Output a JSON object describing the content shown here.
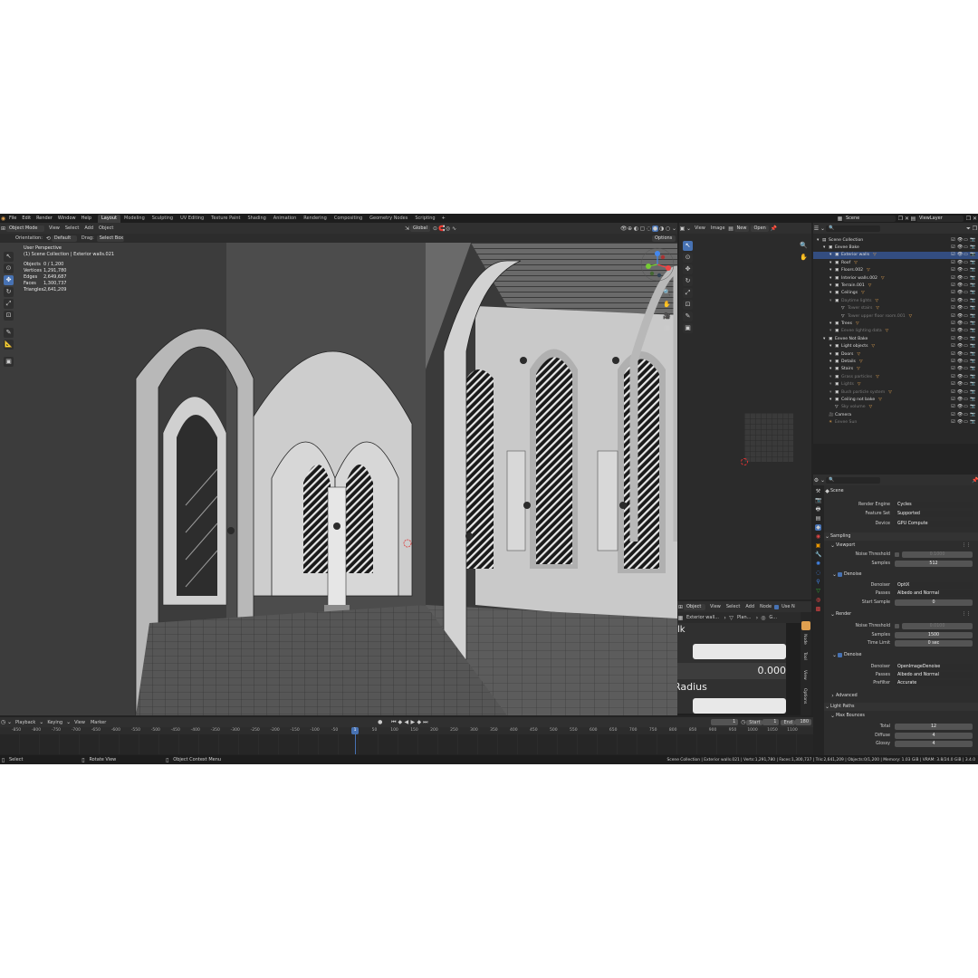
{
  "menu": {
    "items": [
      "File",
      "Edit",
      "Render",
      "Window",
      "Help"
    ],
    "workspaces": [
      "Layout",
      "Modeling",
      "Sculpting",
      "UV Editing",
      "Texture Paint",
      "Shading",
      "Animation",
      "Rendering",
      "Compositing",
      "Geometry Nodes",
      "Scripting"
    ],
    "active_workspace": "Layout",
    "add_tab": "+",
    "scene": "Scene",
    "view_layer": "ViewLayer"
  },
  "viewport": {
    "mode": "Object Mode",
    "menus": [
      "View",
      "Select",
      "Add",
      "Object"
    ],
    "orientation_label": "Orientation:",
    "orientation": "Default",
    "drag_label": "Drag:",
    "drag": "Select Box",
    "transform_orientation": "Global",
    "options": "Options",
    "title": "User Perspective",
    "subtitle": "(1) Scene Collection | Exterior walls.021",
    "stats": [
      {
        "k": "Objects",
        "v": "0 / 1,200"
      },
      {
        "k": "Vertices",
        "v": "1,291,780"
      },
      {
        "k": "Edges",
        "v": "2,649,687"
      },
      {
        "k": "Faces",
        "v": "1,300,737"
      },
      {
        "k": "Triangles",
        "v": "2,641,209"
      }
    ]
  },
  "image_editor": {
    "menus": [
      "View",
      "Image"
    ],
    "new": "New",
    "open": "Open"
  },
  "node_editor": {
    "mode": "Object",
    "menus": [
      "View",
      "Select",
      "Add",
      "Node"
    ],
    "use_label": "Use N",
    "breadcrumb": [
      "Exterior wall...",
      "Plan...",
      "G..."
    ],
    "side_tabs": [
      "Node",
      "Tool",
      "View",
      "Options"
    ],
    "text_fragment": "lk",
    "value_field": "0.000",
    "radius_label": "Radius"
  },
  "outliner": {
    "search_placeholder": "",
    "items": [
      {
        "label": "Scene Collection",
        "depth": 0,
        "kind": "scene"
      },
      {
        "label": "Eevee Bake",
        "depth": 1,
        "kind": "collection"
      },
      {
        "label": "Exterior walls",
        "depth": 2,
        "kind": "collection"
      },
      {
        "label": "Roof",
        "depth": 2,
        "kind": "collection"
      },
      {
        "label": "Floors.002",
        "depth": 2,
        "kind": "collection"
      },
      {
        "label": "Interior walls.002",
        "depth": 2,
        "kind": "collection"
      },
      {
        "label": "Terrain.001",
        "depth": 2,
        "kind": "collection"
      },
      {
        "label": "Ceilings",
        "depth": 2,
        "kind": "collection"
      },
      {
        "label": "Daytime lights",
        "depth": 2,
        "kind": "collection",
        "dim": true
      },
      {
        "label": "Tower stairs",
        "depth": 3,
        "kind": "object",
        "dim": true
      },
      {
        "label": "Tower upper floor room.001",
        "depth": 3,
        "kind": "object",
        "dim": true
      },
      {
        "label": "Trees",
        "depth": 2,
        "kind": "collection"
      },
      {
        "label": "Eevee lighting data",
        "depth": 2,
        "kind": "collection",
        "dim": true
      },
      {
        "label": "Eevee Not Bake",
        "depth": 1,
        "kind": "collection"
      },
      {
        "label": "Light objects",
        "depth": 2,
        "kind": "collection"
      },
      {
        "label": "Doors",
        "depth": 2,
        "kind": "collection"
      },
      {
        "label": "Details",
        "depth": 2,
        "kind": "collection"
      },
      {
        "label": "Stairs",
        "depth": 2,
        "kind": "collection"
      },
      {
        "label": "Grass particles",
        "depth": 2,
        "kind": "collection",
        "dim": true
      },
      {
        "label": "Lights",
        "depth": 2,
        "kind": "collection",
        "dim": true
      },
      {
        "label": "Bush particle system",
        "depth": 2,
        "kind": "collection",
        "dim": true
      },
      {
        "label": "Ceiling not bake",
        "depth": 2,
        "kind": "collection"
      },
      {
        "label": "Sky volume",
        "depth": 2,
        "kind": "object",
        "dim": true
      },
      {
        "label": "Camera",
        "depth": 1,
        "kind": "camera"
      },
      {
        "label": "Eevee Sun",
        "depth": 1,
        "kind": "light",
        "dim": true
      }
    ]
  },
  "properties": {
    "context": "Scene",
    "render_engine_label": "Render Engine",
    "render_engine": "Cycles",
    "feature_set_label": "Feature Set",
    "feature_set": "Supported",
    "device_label": "Device",
    "device": "GPU Compute",
    "sampling": "Sampling",
    "viewport": "Viewport",
    "noise_threshold_label": "Noise Threshold",
    "vp_noise_threshold": "0.1000",
    "samples_label": "Samples",
    "vp_samples": "512",
    "denoise": "Denoise",
    "denoiser_label": "Denoiser",
    "vp_denoiser": "OptiX",
    "passes_label": "Passes",
    "vp_passes": "Albedo and Normal",
    "start_sample_label": "Start Sample",
    "vp_start_sample": "0",
    "render": "Render",
    "r_noise_threshold": "0.0100",
    "r_samples": "1500",
    "time_limit_label": "Time Limit",
    "r_time_limit": "0 sec",
    "r_denoiser": "OpenImageDenoise",
    "r_passes": "Albedo and Normal",
    "prefilter_label": "Prefilter",
    "r_prefilter": "Accurate",
    "advanced": "Advanced",
    "light_paths": "Light Paths",
    "max_bounces": "Max Bounces",
    "total_label": "Total",
    "total": "12",
    "diffuse_label": "Diffuse",
    "diffuse": "4",
    "glossy_label": "Glossy",
    "glossy": "4"
  },
  "timeline": {
    "menus": [
      "Playback",
      "Keying",
      "View",
      "Marker"
    ],
    "current_frame": "1",
    "start_label": "Start",
    "start": "1",
    "end_label": "End",
    "end": "180",
    "ruler": [
      "-850",
      "-800",
      "-750",
      "-700",
      "-650",
      "-600",
      "-550",
      "-500",
      "-450",
      "-400",
      "-350",
      "-300",
      "-250",
      "-200",
      "-150",
      "-100",
      "-50",
      "1",
      "50",
      "100",
      "150",
      "200",
      "250",
      "300",
      "350",
      "400",
      "450",
      "500",
      "550",
      "600",
      "650",
      "700",
      "750",
      "800",
      "850",
      "900",
      "950",
      "1000",
      "1050",
      "1100"
    ],
    "ruler_min": -850,
    "ruler_max": 1100,
    "playhead": 1
  },
  "status": {
    "select": "Select",
    "rotate": "Rotate View",
    "context_menu": "Object Context Menu",
    "info": "Scene Collection | Exterior walls.021 | Verts:1,291,780 | Faces:1,300,737 | Tris:2,641,209 | Objects:0/1,200 | Memory: 1.03 GiB | VRAM: 3.8/24.0 GiB | 3.4.0"
  },
  "colors": {
    "accent": "#4772b3",
    "bg": "#232323",
    "panel": "#2b2b2b",
    "header": "#303030",
    "orange": "#e0a050"
  }
}
